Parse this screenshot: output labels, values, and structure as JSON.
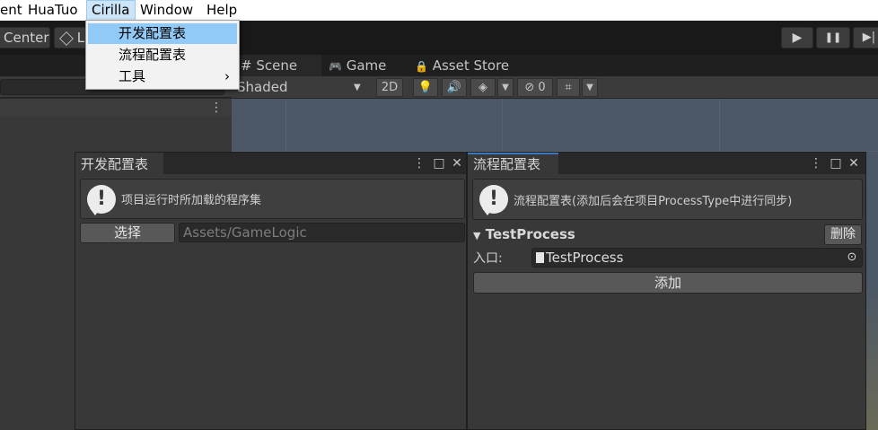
{
  "menubar": {
    "items": [
      "ent",
      "HuaTuo",
      "Cirilla",
      "Window",
      "Help"
    ],
    "active_index": 2
  },
  "dropdown": {
    "items": [
      "开发配置表",
      "流程配置表",
      "工具"
    ],
    "highlighted_index": 0,
    "submenu_arrow": "›"
  },
  "toolbar": {
    "center_label": "Center",
    "layers_label": "L",
    "play_icon": "▶",
    "pause_icon": "❚❚",
    "step_icon": "▶|"
  },
  "scene": {
    "tabs": [
      {
        "icon": "#",
        "label": "Scene"
      },
      {
        "icon": "🎮",
        "label": "Game"
      },
      {
        "icon": "🔒",
        "label": "Asset Store"
      }
    ],
    "shading_mode": "Shaded",
    "mode_2d": "2D",
    "hidden_count": "0",
    "background_color": "#4b5666"
  },
  "dev_window": {
    "tab_title": "开发配置表",
    "help_text": "项目运行时所加载的程序集",
    "select_button": "选择",
    "path_placeholder": "Assets/GameLogic"
  },
  "flow_window": {
    "tab_title": "流程配置表",
    "help_text": "流程配置表(添加后会在项目ProcessType中进行同步)",
    "process_name": "TestProcess",
    "delete_button": "删除",
    "entry_label": "入口:",
    "entry_value": "TestProcess",
    "add_button": "添加"
  },
  "window_controls": {
    "more": "⋮",
    "maximize": "□",
    "close": "✕"
  },
  "accent_color": "#3a79bb"
}
